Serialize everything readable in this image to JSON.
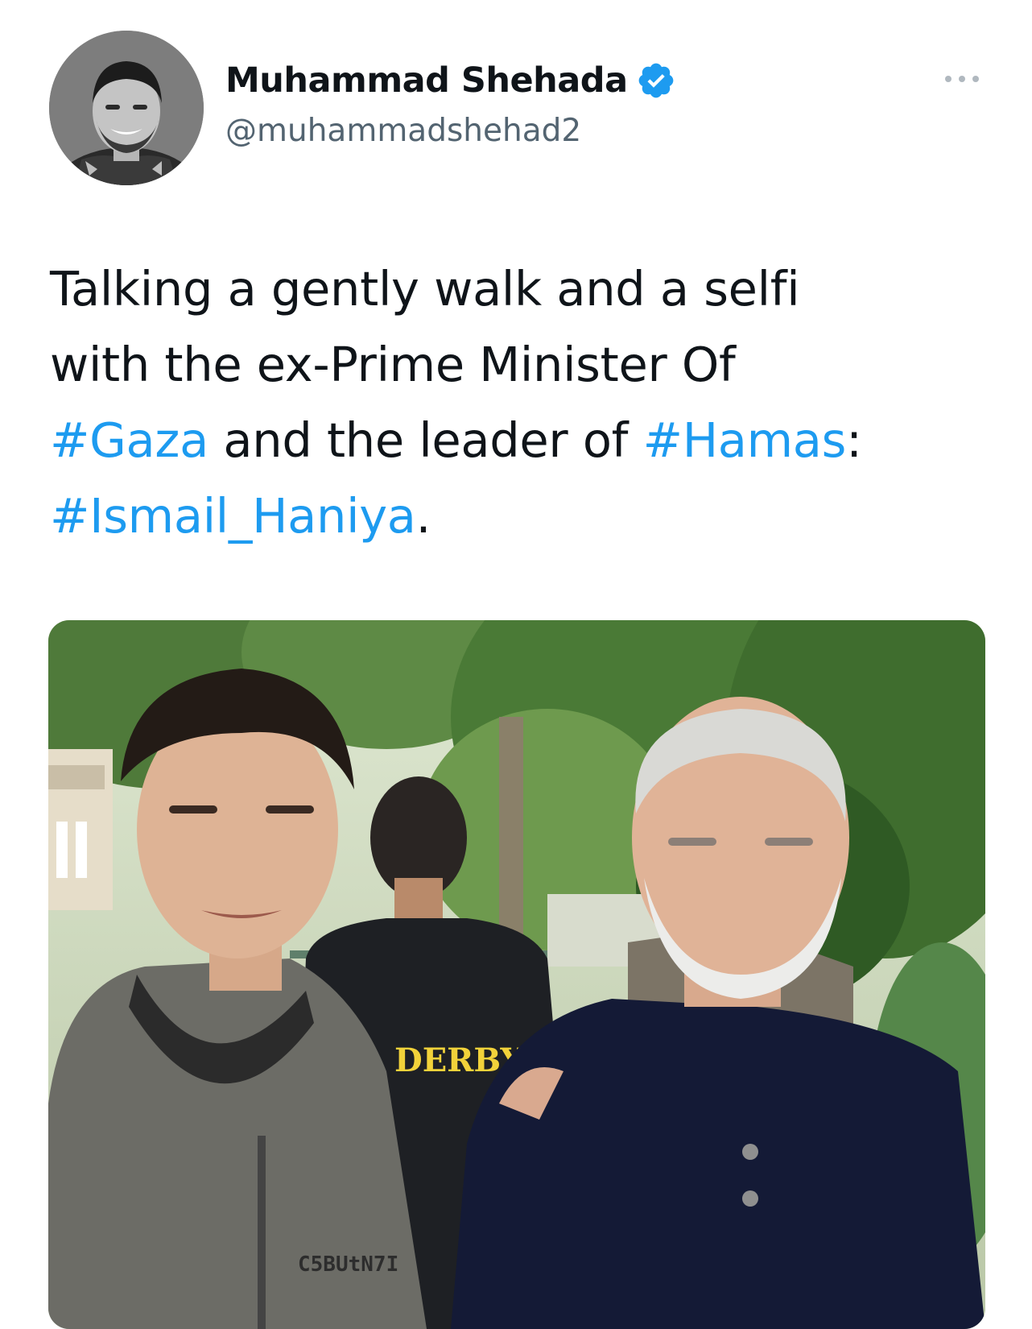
{
  "author": {
    "display_name": "Muhammad Shehada",
    "handle": "@muhammadshehad2",
    "verified": true,
    "avatar_icon": "profile-photo"
  },
  "tweet": {
    "line1": "Talking a gently walk and a selfi",
    "line2": "with the ex-Prime Minister Of",
    "line3_hashtag1": "#Gaza",
    "line3_mid": " and the leader of ",
    "line3_hashtag2": "#Hamas",
    "line3_end": ":",
    "line4_hashtag": "#Ismail_Haniya",
    "line4_end": "."
  },
  "media": {
    "jacket_text": "DERBY",
    "hoodie_text": "C5BUtN7I"
  },
  "colors": {
    "accent": "#1d9bf0",
    "text_primary": "#0f1419",
    "text_secondary": "#536471"
  },
  "icons": {
    "verified": "verified-badge-icon",
    "more": "more-options-icon"
  }
}
